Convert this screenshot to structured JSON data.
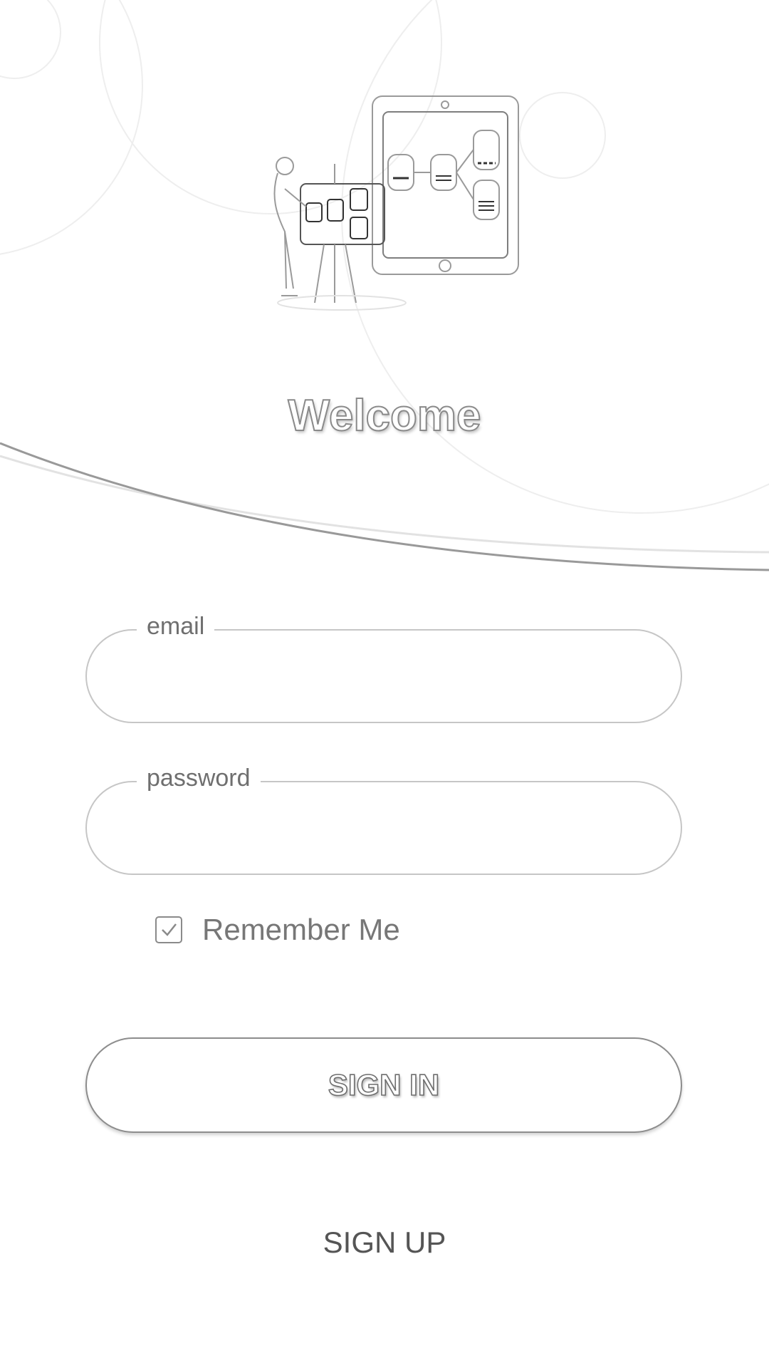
{
  "hero": {
    "title": "Welcome",
    "illustration": "woman-presenting-flowchart-tablet-illustration"
  },
  "form": {
    "email": {
      "label": "email",
      "value": "",
      "placeholder": ""
    },
    "password": {
      "label": "password",
      "value": "",
      "placeholder": ""
    },
    "remember": {
      "label": "Remember Me",
      "checked": true,
      "icon": "checkmark-icon"
    }
  },
  "actions": {
    "sign_in_label": "SIGN IN",
    "sign_up_label": "SIGN UP"
  },
  "colors": {
    "background": "#ffffff",
    "outline": "#c6c6c6",
    "text_muted": "#777777"
  }
}
